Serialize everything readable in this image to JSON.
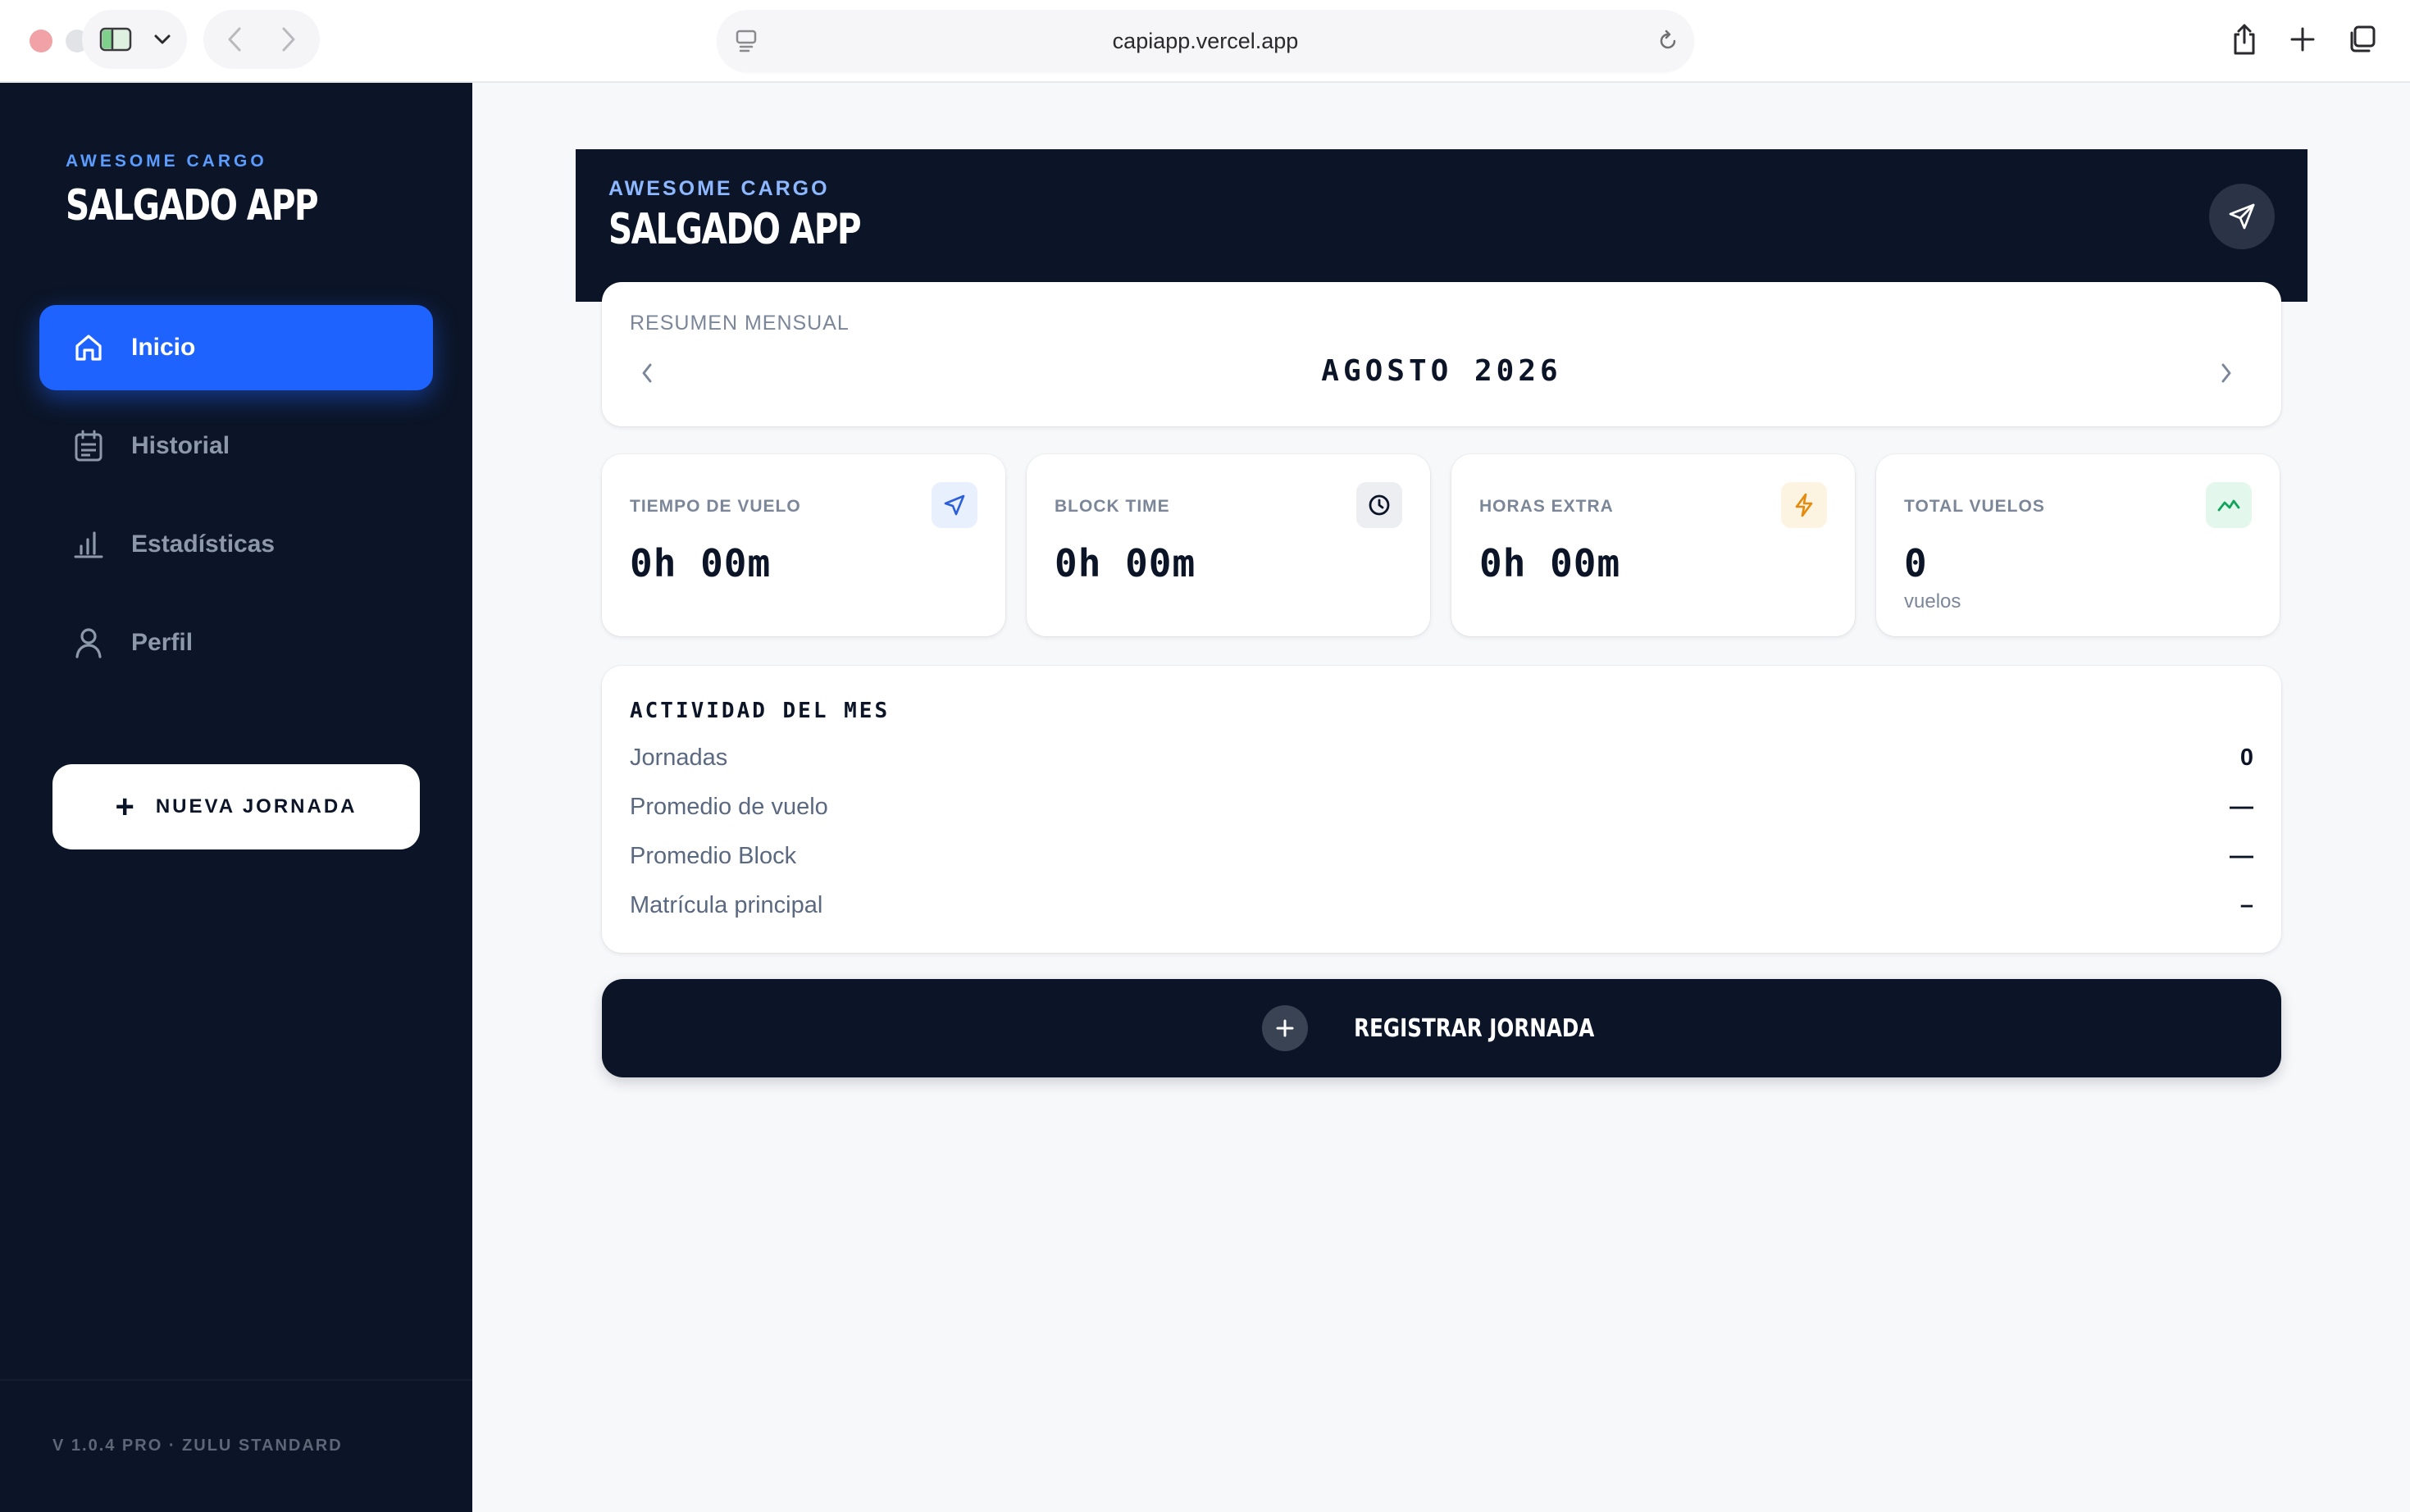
{
  "browser": {
    "url": "capiapp.vercel.app"
  },
  "sidebar": {
    "brand_small": "AWESOME CARGO",
    "brand_big": "SALGADO APP",
    "items": [
      {
        "label": "Inicio",
        "icon": "home-icon",
        "active": true
      },
      {
        "label": "Historial",
        "icon": "calendar-list-icon",
        "active": false
      },
      {
        "label": "Estadísticas",
        "icon": "bar-chart-icon",
        "active": false
      },
      {
        "label": "Perfil",
        "icon": "user-icon",
        "active": false
      }
    ],
    "new_button": "NUEVA JORNADA",
    "version": "V 1.0.4 PRO · ZULU STANDARD"
  },
  "header": {
    "small": "AWESOME CARGO",
    "big": "SALGADO APP",
    "action_icon": "paper-plane-icon"
  },
  "summary": {
    "label": "RESUMEN MENSUAL",
    "month": "AGOSTO 2026"
  },
  "stats": [
    {
      "label": "TIEMPO DE VUELO",
      "value": "0h 00m",
      "sub": "",
      "icon": "plane-icon",
      "icon_color": "#2b5fd9",
      "icon_bg": "#e8effd"
    },
    {
      "label": "BLOCK TIME",
      "value": "0h 00m",
      "sub": "",
      "icon": "clock-icon",
      "icon_color": "#0c1527",
      "icon_bg": "#eceef2"
    },
    {
      "label": "HORAS EXTRA",
      "value": "0h 00m",
      "sub": "",
      "icon": "bolt-icon",
      "icon_color": "#e58a0b",
      "icon_bg": "#fdf3e1"
    },
    {
      "label": "TOTAL VUELOS",
      "value": "0",
      "sub": "vuelos",
      "icon": "trend-icon",
      "icon_color": "#10a55a",
      "icon_bg": "#e4f7ec"
    }
  ],
  "activity": {
    "title": "ACTIVIDAD DEL MES",
    "rows": [
      {
        "key": "Jornadas",
        "value": "0"
      },
      {
        "key": "Promedio de vuelo",
        "value": "—"
      },
      {
        "key": "Promedio Block",
        "value": "—"
      },
      {
        "key": "Matrícula principal",
        "value": "–"
      }
    ]
  },
  "register_button": "REGISTRAR JORNADA",
  "colors": {
    "navy": "#0c1527",
    "accent": "#1f63ff",
    "muted": "#7b8799"
  }
}
